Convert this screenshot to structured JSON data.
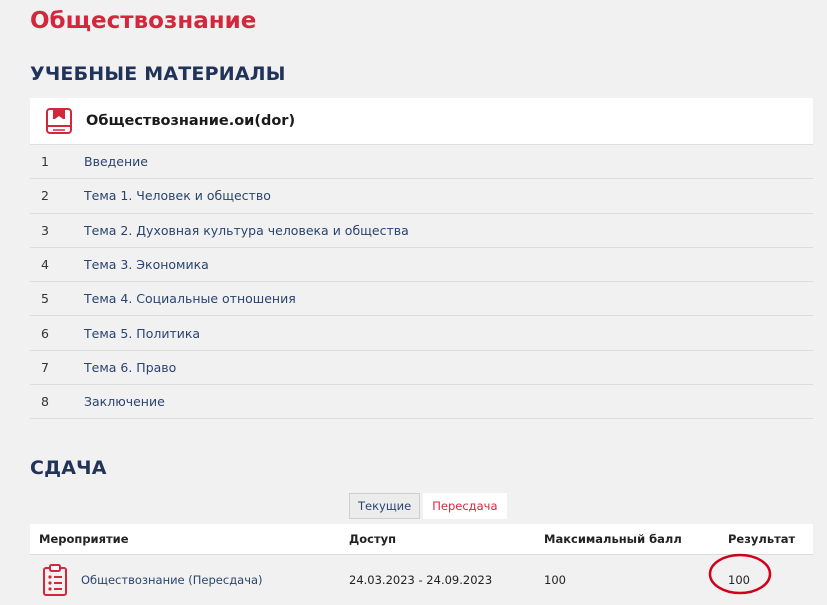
{
  "page": {
    "title": "Обществознание"
  },
  "materials": {
    "section_title": "УЧЕБНЫЕ МАТЕРИАЛЫ",
    "course_name": "Обществознание.ои(dor)",
    "course_icon": "book-icon",
    "topics": [
      {
        "num": "1",
        "label": "Введение"
      },
      {
        "num": "2",
        "label": "Тема 1. Человек и общество"
      },
      {
        "num": "3",
        "label": "Тема 2. Духовная культура человека и общества"
      },
      {
        "num": "4",
        "label": "Тема 3. Экономика"
      },
      {
        "num": "5",
        "label": "Тема 4. Социальные отношения"
      },
      {
        "num": "6",
        "label": "Тема 5. Политика"
      },
      {
        "num": "7",
        "label": "Тема 6. Право"
      },
      {
        "num": "8",
        "label": "Заключение"
      }
    ]
  },
  "exam": {
    "section_title": "СДАЧА",
    "tabs": [
      {
        "label": "Текущие",
        "active": false
      },
      {
        "label": "Пересдача",
        "active": true
      }
    ],
    "columns": {
      "event": "Мероприятие",
      "access": "Доступ",
      "max_score": "Максимальный балл",
      "result": "Результат"
    },
    "rows": [
      {
        "icon": "checklist-icon",
        "event": "Обществознание (Пересдача)",
        "access": "24.03.2023 - 24.09.2023",
        "max_score": "100",
        "result": "100"
      }
    ]
  },
  "colors": {
    "accent_red": "#d3273d",
    "heading_navy": "#22335a",
    "link_blue": "#2a4470",
    "annotation_red": "#d0021b"
  }
}
